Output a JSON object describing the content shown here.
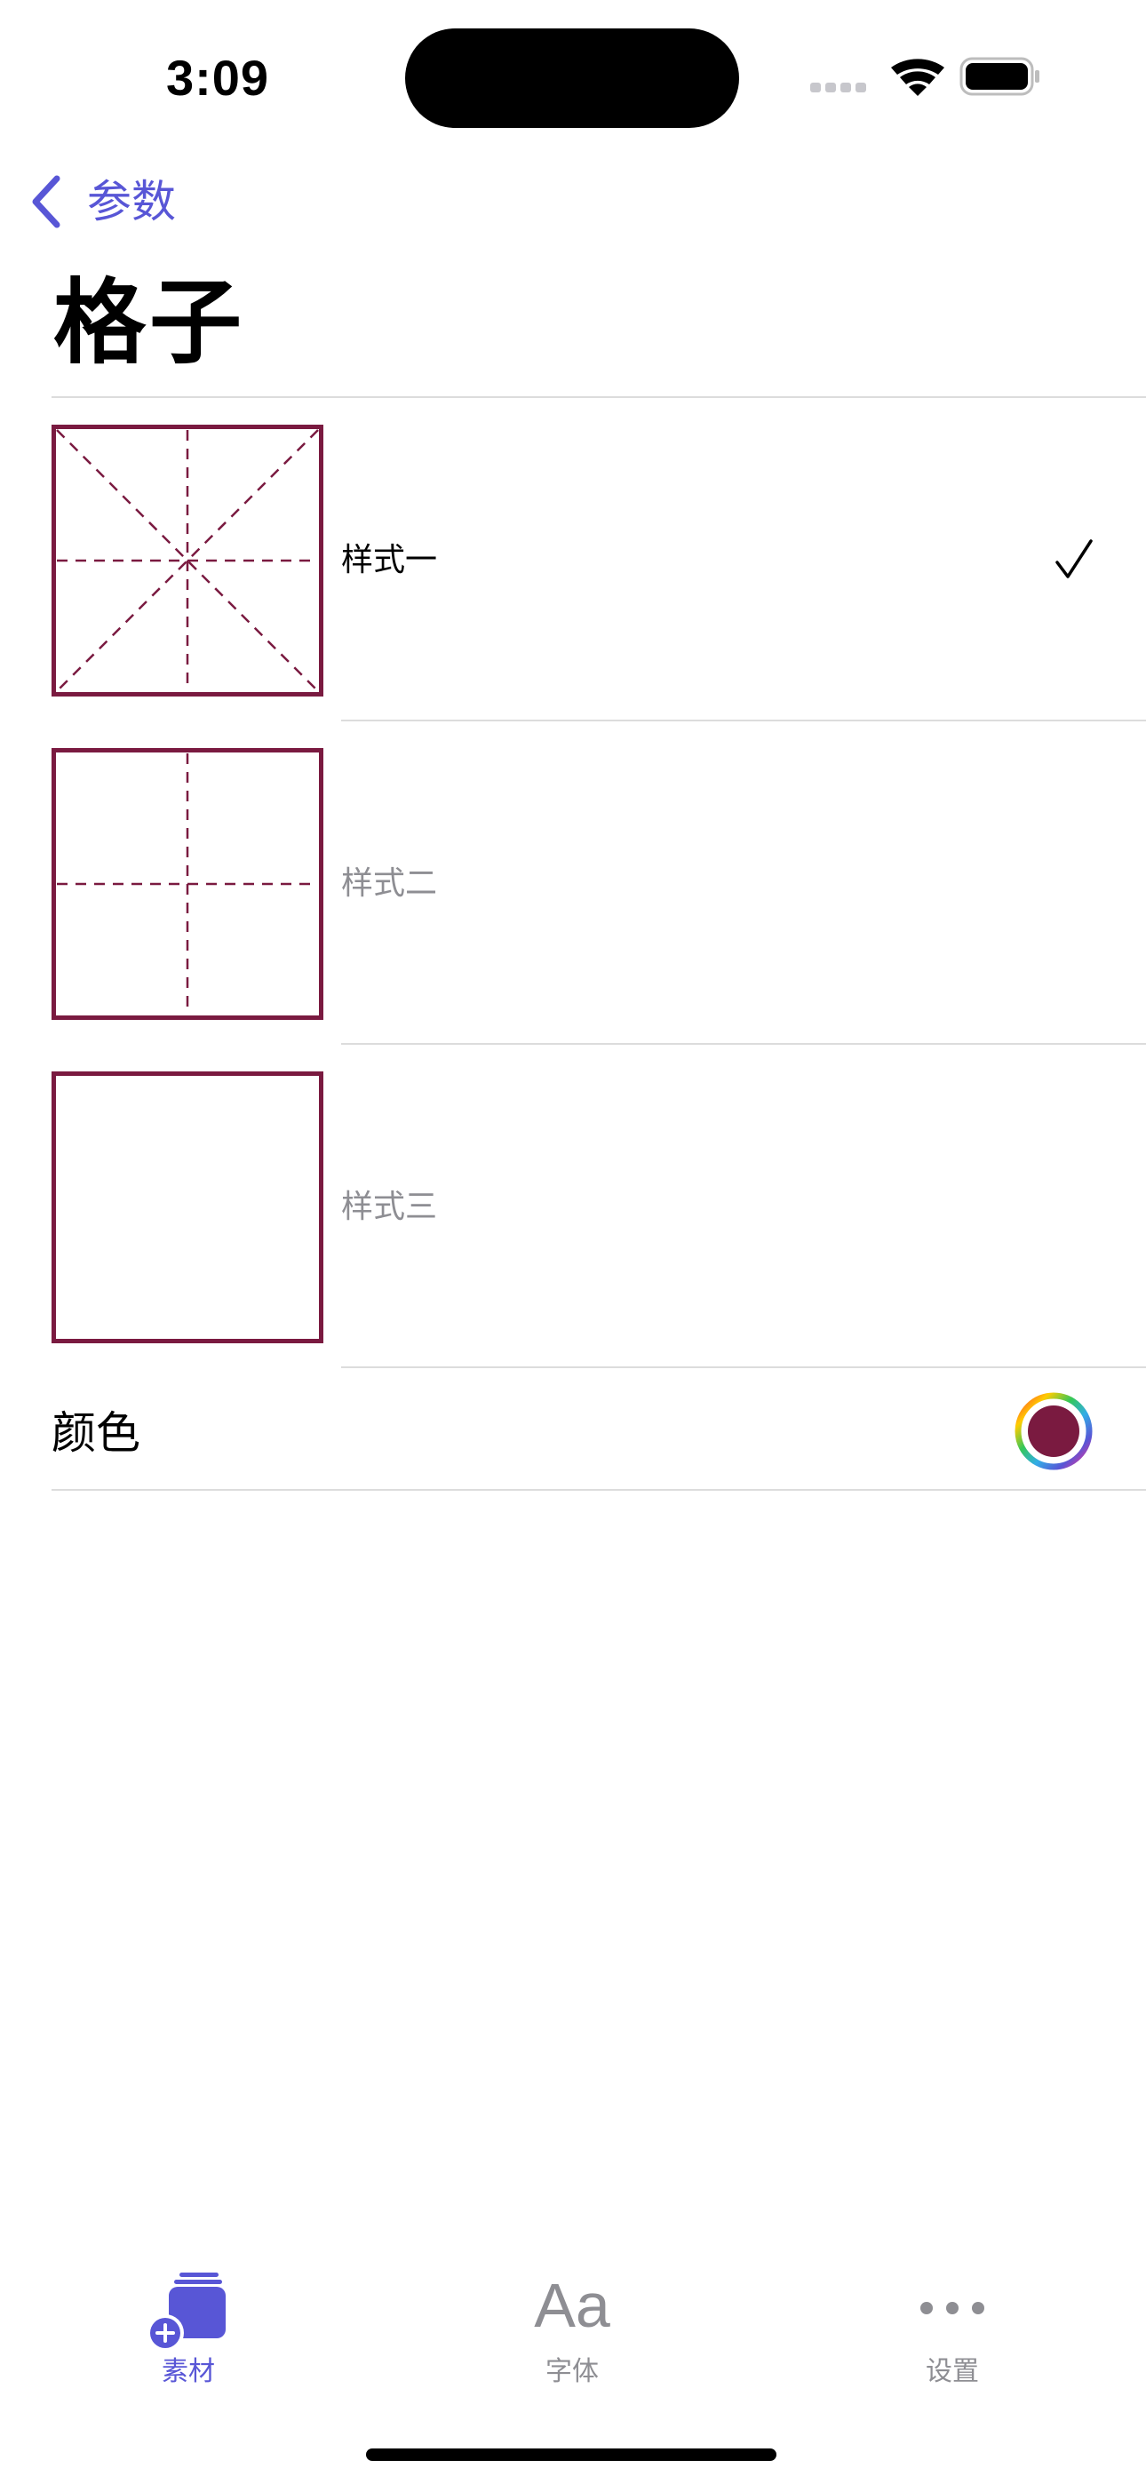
{
  "status_bar": {
    "time": "3:09"
  },
  "nav": {
    "back_label": "参数",
    "title": "格子"
  },
  "grid_styles": [
    {
      "label": "样式一",
      "selected": true
    },
    {
      "label": "样式二",
      "selected": false
    },
    {
      "label": "样式三",
      "selected": false
    }
  ],
  "color_row": {
    "label": "颜色",
    "value": "#7a1a40"
  },
  "colors": {
    "accent": "#5856d6",
    "grid_line": "#7a1a40",
    "inactive": "#8e8e93"
  },
  "tab_bar": {
    "tabs": [
      {
        "label": "素材",
        "icon": "add-stack-icon",
        "active": true
      },
      {
        "label": "字体",
        "glyph": "Aa",
        "icon": "font-icon",
        "active": false
      },
      {
        "label": "设置",
        "icon": "ellipsis-icon",
        "active": false
      }
    ]
  }
}
